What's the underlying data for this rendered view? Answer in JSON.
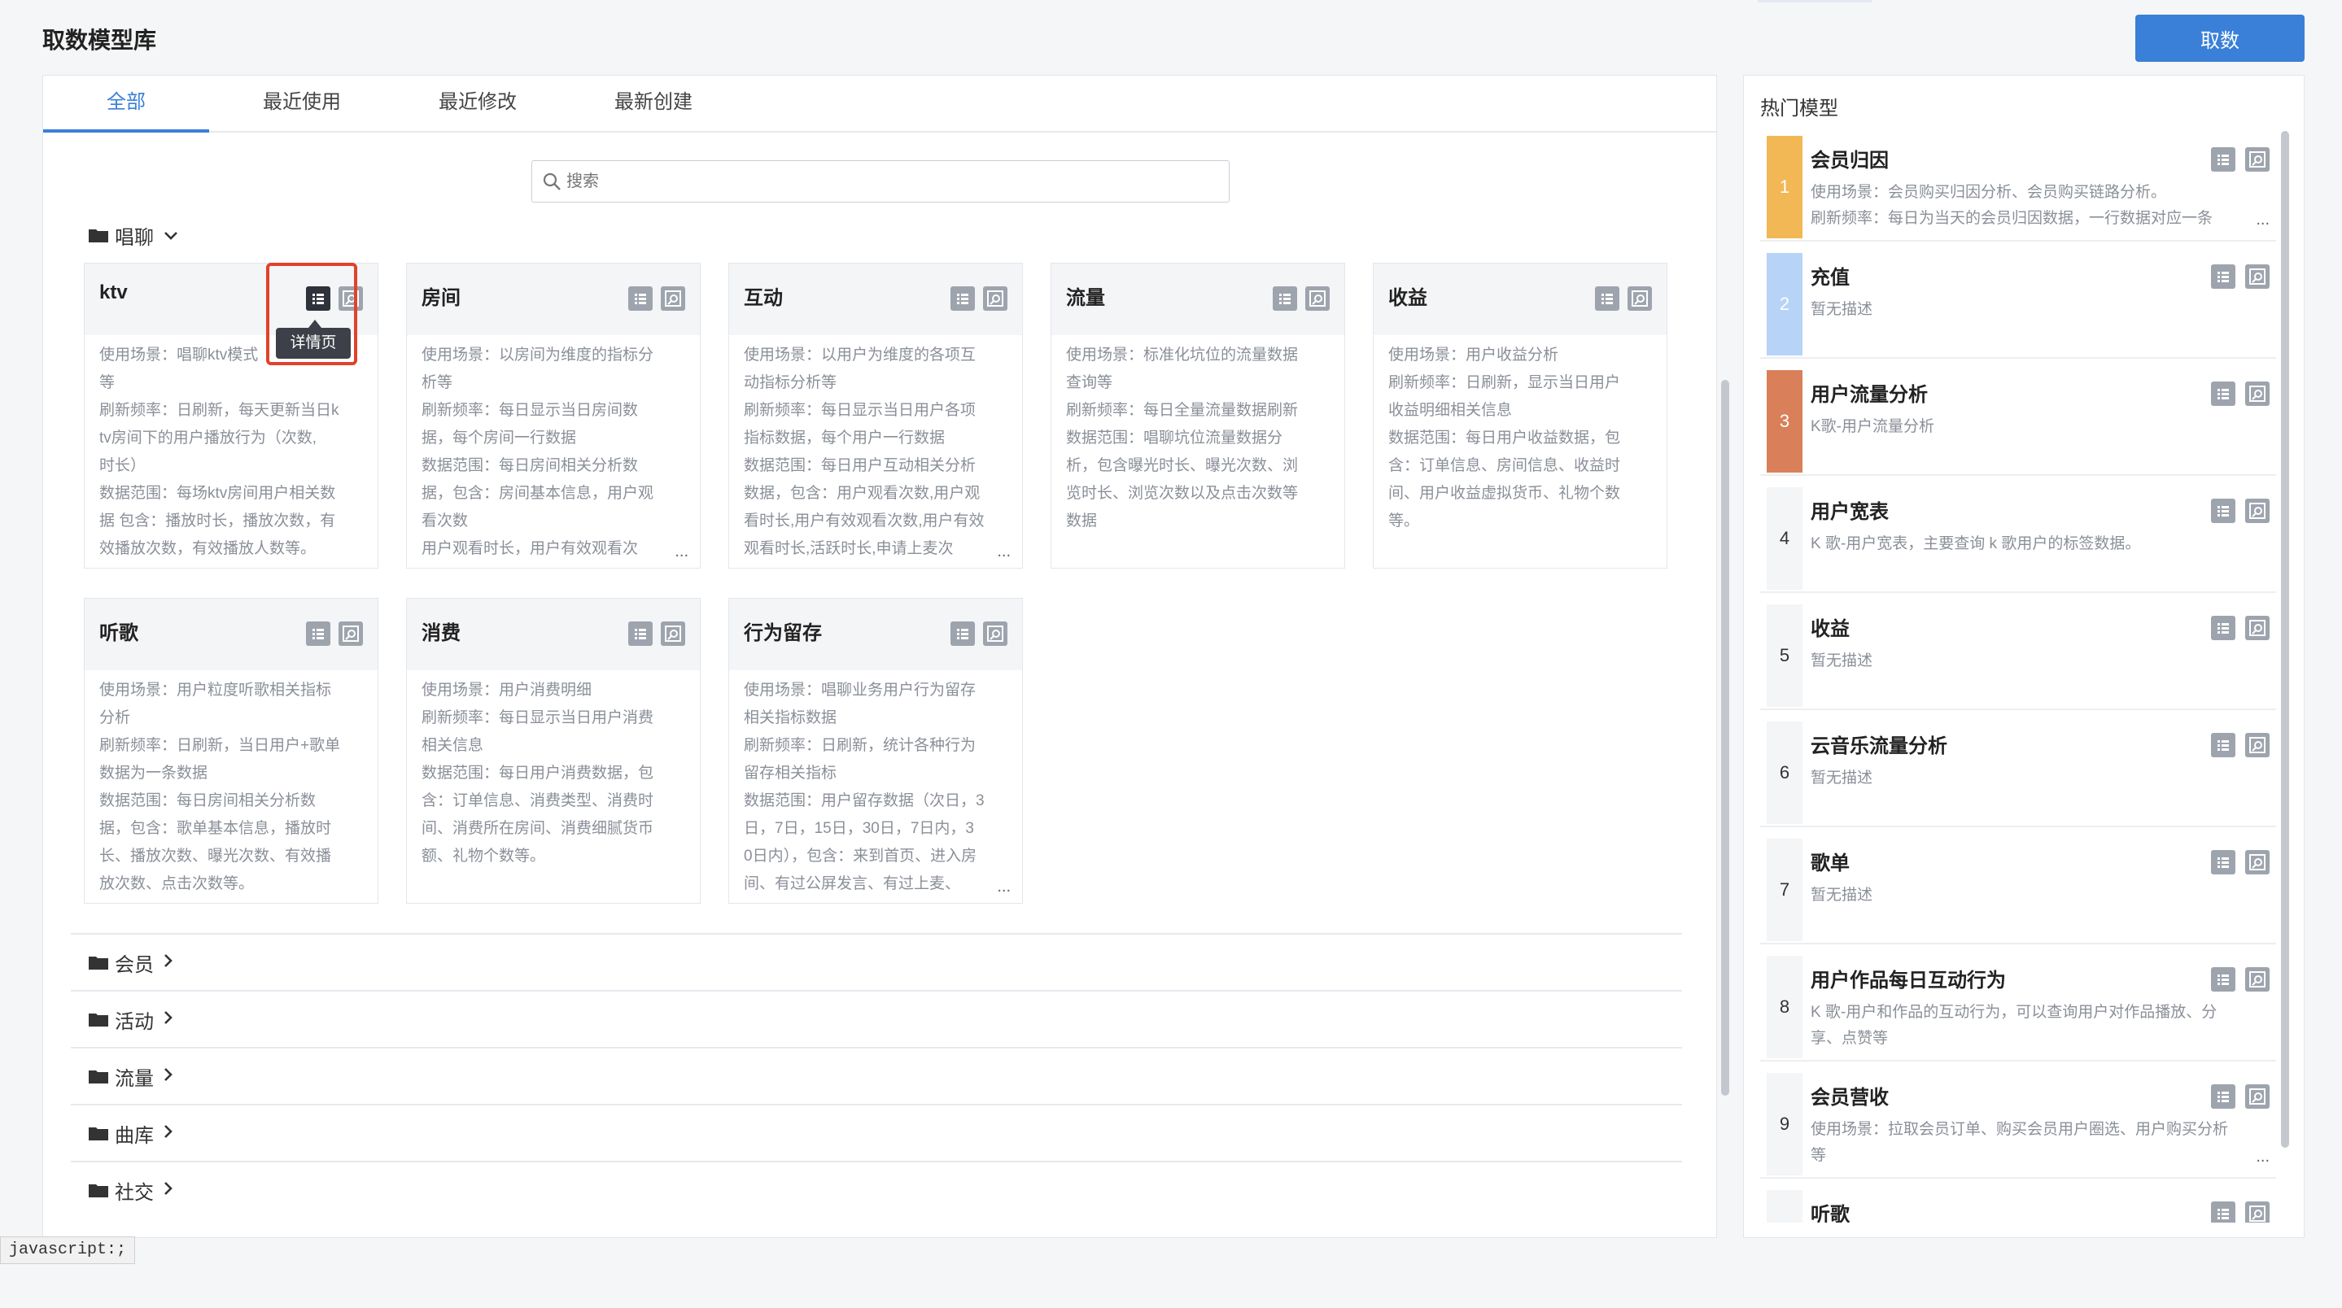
{
  "page": {
    "title": "取数模型库",
    "primary_button": "取数"
  },
  "tabs": [
    {
      "label": "全部",
      "active": true
    },
    {
      "label": "最近使用",
      "active": false
    },
    {
      "label": "最近修改",
      "active": false
    },
    {
      "label": "最新创建",
      "active": false
    }
  ],
  "search": {
    "placeholder": "搜索"
  },
  "open_group": {
    "name": "唱聊",
    "cards": [
      {
        "title": "ktv",
        "lines": [
          "使用场景：唱聊ktv模式",
          "等",
          "刷新频率：日刷新，每天更新当日k",
          "tv房间下的用户播放行为（次数,",
          "时长）",
          "数据范围：每场ktv房间用户相关数",
          "据 包含：播放时长，播放次数，有",
          "效播放次数，有效播放人数等。"
        ]
      },
      {
        "title": "房间",
        "lines": [
          "使用场景：以房间为维度的指标分",
          "析等",
          "刷新频率：每日显示当日房间数",
          "据，每个房间一行数据",
          "数据范围：每日房间相关分析数",
          "据，包含：房间基本信息，用户观",
          "看次数",
          "用户观看时长，用户有效观看次"
        ],
        "ellipsis": "..."
      },
      {
        "title": "互动",
        "lines": [
          "使用场景：以用户为维度的各项互",
          "动指标分析等",
          "刷新频率：每日显示当日用户各项",
          "指标数据，每个用户一行数据",
          "数据范围：每日用户互动相关分析",
          "数据，包含：用户观看次数,用户观",
          "看时长,用户有效观看次数,用户有效",
          "观看时长,活跃时长,申请上麦次"
        ],
        "ellipsis": "..."
      },
      {
        "title": "流量",
        "lines": [
          "使用场景：标准化坑位的流量数据",
          "查询等",
          "刷新频率：每日全量流量数据刷新",
          "数据范围：唱聊坑位流量数据分",
          "析，包含曝光时长、曝光次数、浏",
          "览时长、浏览次数以及点击次数等",
          "数据"
        ]
      },
      {
        "title": "收益",
        "lines": [
          "使用场景：用户收益分析",
          "刷新频率：日刷新，显示当日用户",
          "收益明细相关信息",
          "数据范围：每日用户收益数据，包",
          "含：订单信息、房间信息、收益时",
          "间、用户收益虚拟货币、礼物个数",
          "等。"
        ]
      },
      {
        "title": "听歌",
        "lines": [
          "使用场景：用户粒度听歌相关指标",
          "分析",
          "刷新频率：日刷新，当日用户+歌单",
          "数据为一条数据",
          "数据范围：每日房间相关分析数",
          "据，包含：歌单基本信息，播放时",
          "长、播放次数、曝光次数、有效播",
          "放次数、点击次数等。"
        ]
      },
      {
        "title": "消费",
        "lines": [
          "使用场景：用户消费明细",
          "刷新频率：每日显示当日用户消费",
          "相关信息",
          "数据范围：每日用户消费数据，包",
          "含：订单信息、消费类型、消费时",
          "间、消费所在房间、消费细腻货币",
          "额、礼物个数等。"
        ]
      },
      {
        "title": "行为留存",
        "lines": [
          "使用场景：唱聊业务用户行为留存",
          "相关指标数据",
          "刷新频率：日刷新，统计各种行为",
          "留存相关指标",
          "数据范围：用户留存数据（次日，3",
          "日，7日，15日，30日，7日内，3",
          "0日内），包含：来到首页、进入房",
          "间、有过公屏发言、有过上麦、"
        ],
        "ellipsis": "..."
      }
    ]
  },
  "tooltip": "详情页",
  "collapsed_groups": [
    "会员",
    "活动",
    "流量",
    "曲库",
    "社交"
  ],
  "hot": {
    "title": "热门模型",
    "items": [
      {
        "rank": "1",
        "name": "会员归因",
        "lines": [
          "使用场景：会员购买归因分析、会员购买链路分析。",
          "刷新频率：每日为当天的会员归因数据，一行数据对应一条"
        ],
        "ellipsis": "...",
        "color": "#f2b855"
      },
      {
        "rank": "2",
        "name": "充值",
        "lines": [
          "暂无描述"
        ],
        "color": "#b7d3f7"
      },
      {
        "rank": "3",
        "name": "用户流量分析",
        "lines": [
          "K歌-用户流量分析"
        ],
        "color": "#d9805a"
      },
      {
        "rank": "4",
        "name": "用户宽表",
        "lines": [
          "K 歌-用户宽表，主要查询 k 歌用户的标签数据。"
        ]
      },
      {
        "rank": "5",
        "name": "收益",
        "lines": [
          "暂无描述"
        ]
      },
      {
        "rank": "6",
        "name": "云音乐流量分析",
        "lines": [
          "暂无描述"
        ]
      },
      {
        "rank": "7",
        "name": "歌单",
        "lines": [
          "暂无描述"
        ]
      },
      {
        "rank": "8",
        "name": "用户作品每日互动行为",
        "lines": [
          "K 歌-用户和作品的互动行为，可以查询用户对作品播放、分",
          "享、点赞等"
        ]
      },
      {
        "rank": "9",
        "name": "会员营收",
        "lines": [
          "使用场景：拉取会员订单、购买会员用户圈选、用户购买分析",
          "等"
        ],
        "ellipsis": "..."
      },
      {
        "rank": "",
        "name": "听歌",
        "lines": []
      }
    ]
  },
  "status_bar": "javascript:;",
  "icons": [
    "folder-icon",
    "chevron-down-icon",
    "chevron-right-icon",
    "search-icon",
    "list-icon",
    "zoom-icon"
  ]
}
